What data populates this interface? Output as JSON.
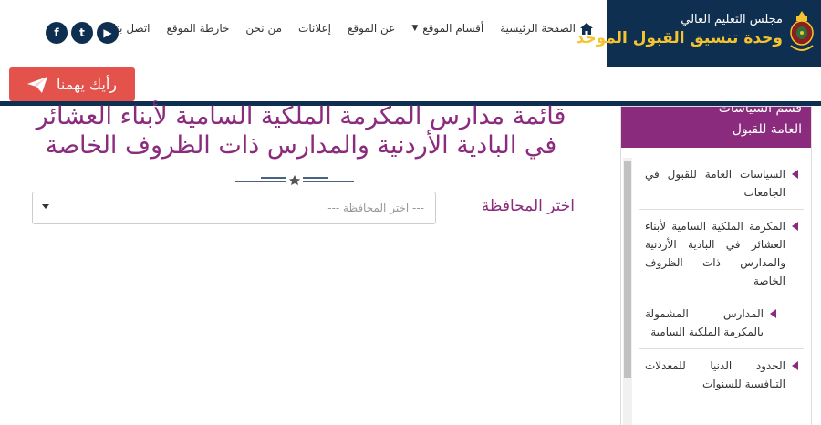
{
  "logo": {
    "line1": "مجلس التعليم العالي",
    "line2": "وحدة تنسيق القبول الموحد"
  },
  "nav": {
    "items": [
      {
        "label": "الصفحة الرئيسية"
      },
      {
        "label": "أقسام الموقع"
      },
      {
        "label": "عن الموقع"
      },
      {
        "label": "إعلانات"
      },
      {
        "label": "من نحن"
      },
      {
        "label": "خارطة الموقع"
      },
      {
        "label": "اتصل بنا"
      }
    ]
  },
  "social": {
    "facebook": "f",
    "twitter": "t",
    "youtube": "▶"
  },
  "feedback": {
    "label": "رأيك يهمنا"
  },
  "page": {
    "title_line1": "قائمة مدارس المكرمة الملكية السامية لأبناء العشائر",
    "title_line2": "في البادية الأردنية والمدارس ذات الظروف الخاصة"
  },
  "filter": {
    "label": "اختر المحافظة",
    "placeholder": "--- اختر المحافظة ---"
  },
  "sidebar": {
    "head_line1": "قسم السياسات",
    "head_line2": "العامة للقبول",
    "items": [
      {
        "label": "السياسات العامة للقبول في الجامعات"
      },
      {
        "label": "المكرمة الملكية السامية لأبناء العشائر في البادية الأردنية والمدارس ذات الظروف الخاصة"
      },
      {
        "label": "المدارس المشمولة بالمكرمة الملكية السامية"
      },
      {
        "label": "الحدود الدنيا للمعدلات التنافسية للسنوات"
      }
    ]
  },
  "colors": {
    "navy": "#0f2f51",
    "purple": "#8b2b7d",
    "red": "#e3524b",
    "gold": "#f4c430"
  }
}
